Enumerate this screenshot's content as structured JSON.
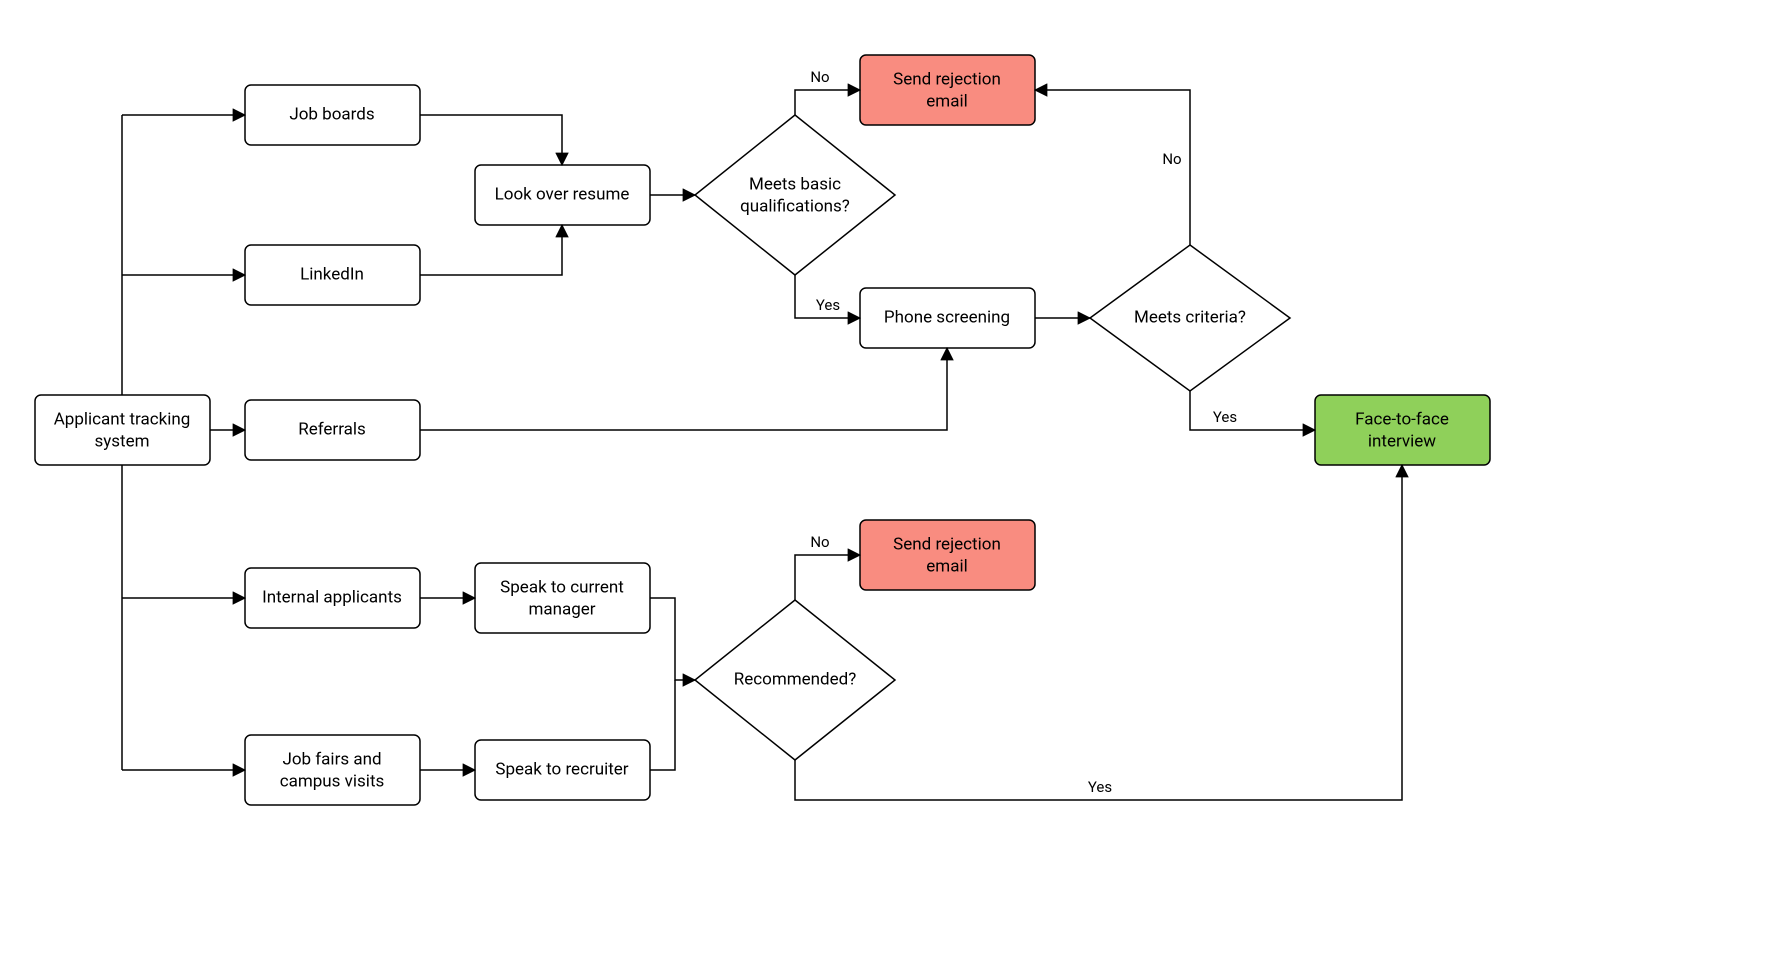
{
  "nodes": {
    "ats": {
      "label1": "Applicant tracking",
      "label2": "system"
    },
    "jobBoards": {
      "label": "Job boards"
    },
    "linkedin": {
      "label": "LinkedIn"
    },
    "referrals": {
      "label": "Referrals"
    },
    "internal": {
      "label": "Internal applicants"
    },
    "jobFairs": {
      "label1": "Job fairs and",
      "label2": "campus visits"
    },
    "lookResume": {
      "label": "Look over resume"
    },
    "speakManager": {
      "label1": "Speak to current",
      "label2": "manager"
    },
    "speakRecruiter": {
      "label": "Speak to recruiter"
    },
    "phoneScreen": {
      "label": "Phone screening"
    },
    "reject1": {
      "label1": "Send rejection",
      "label2": "email"
    },
    "reject2": {
      "label1": "Send rejection",
      "label2": "email"
    },
    "f2f": {
      "label1": "Face-to-face",
      "label2": "interview"
    }
  },
  "decisions": {
    "meetsBasic": {
      "label1": "Meets basic",
      "label2": "qualifications?"
    },
    "meetsCriteria": {
      "label": "Meets criteria?"
    },
    "recommended": {
      "label": "Recommended?"
    }
  },
  "edgeLabels": {
    "yes": "Yes",
    "no": "No"
  },
  "colors": {
    "reject": "#f98c80",
    "accept": "#8fd05a"
  }
}
